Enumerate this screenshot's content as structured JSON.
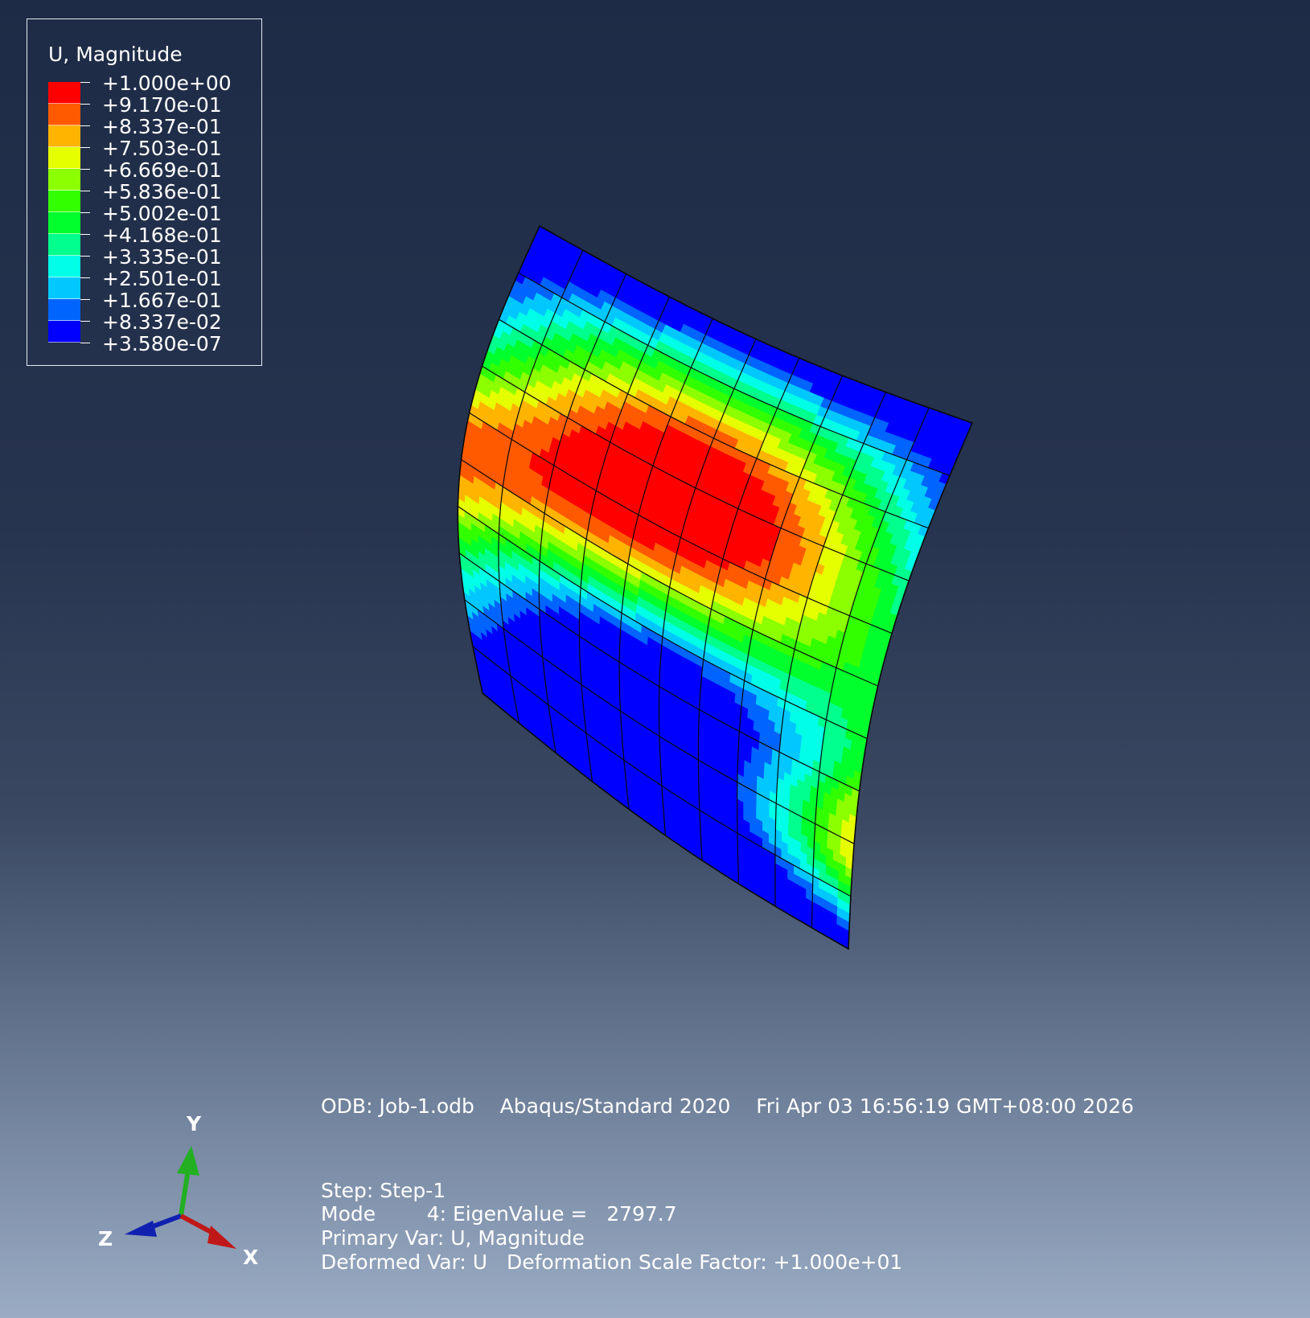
{
  "legend": {
    "title": "U, Magnitude",
    "levels": [
      {
        "label": "+1.000e+00",
        "color": "#ff0000"
      },
      {
        "label": "+9.170e-01",
        "color": "#ff5a00"
      },
      {
        "label": "+8.337e-01",
        "color": "#ffb400"
      },
      {
        "label": "+7.503e-01",
        "color": "#e6ff00"
      },
      {
        "label": "+6.669e-01",
        "color": "#8cff00"
      },
      {
        "label": "+5.836e-01",
        "color": "#32ff00"
      },
      {
        "label": "+5.002e-01",
        "color": "#00ff2d"
      },
      {
        "label": "+4.168e-01",
        "color": "#00ff8c"
      },
      {
        "label": "+3.335e-01",
        "color": "#00ffe6"
      },
      {
        "label": "+2.501e-01",
        "color": "#00c8ff"
      },
      {
        "label": "+1.667e-01",
        "color": "#0064ff"
      },
      {
        "label": "+8.337e-02",
        "color": "#0000ff"
      },
      {
        "label": "+3.580e-07",
        "color": ""
      }
    ]
  },
  "info": {
    "odb_line": "ODB: Job-1.odb    Abaqus/Standard 2020    Fri Apr 03 16:56:19 GMT+08:00 2026",
    "step_line": "Step: Step-1",
    "mode_line": "Mode        4: EigenValue =   2797.7",
    "primary_line": "Primary Var: U, Magnitude",
    "deformed_line": "Deformed Var: U   Deformation Scale Factor: +1.000e+01"
  },
  "triad": {
    "y_label": "Y",
    "z_label": "Z",
    "x_label": "X",
    "y_color": "#22b022",
    "z_color": "#1020b0",
    "x_color": "#c01818"
  },
  "mesh": {
    "rows": 10,
    "cols": 10,
    "line_color": "#0a0a0a"
  }
}
